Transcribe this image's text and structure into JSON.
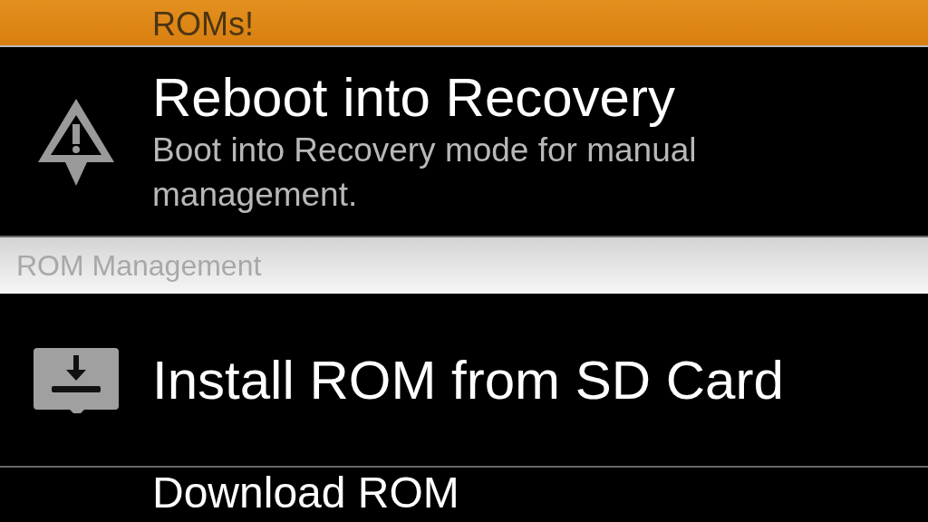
{
  "banner": {
    "text": "ROMs!"
  },
  "items": [
    {
      "kind": "warning",
      "title": "Reboot into Recovery",
      "subtitle": "Boot into Recovery mode for manual management."
    }
  ],
  "section": {
    "title": "ROM Management"
  },
  "section_items": [
    {
      "kind": "sdcard",
      "title": "Install ROM from SD Card"
    },
    {
      "kind": "none",
      "title": "Download ROM"
    }
  ]
}
